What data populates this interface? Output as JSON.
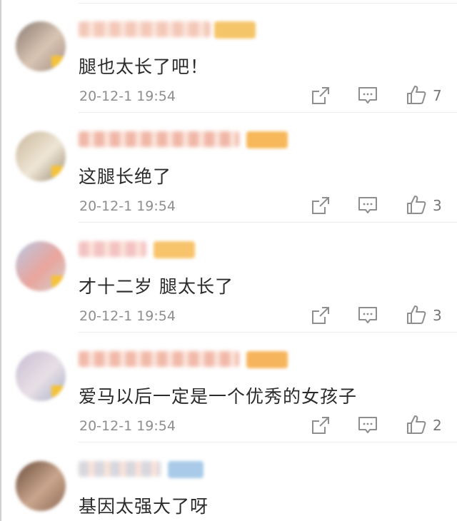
{
  "comments": [
    {
      "text": "腿也太长了吧！",
      "time": "20-12-1 19:54",
      "likes": "7",
      "avatar_colors": [
        "#8a7b73",
        "#d9c5b3",
        "#a58f86"
      ],
      "username_color": "#f3c8b8",
      "badge_color": "#f5c56a"
    },
    {
      "text": "这腿长绝了",
      "time": "20-12-1 19:54",
      "likes": "3",
      "avatar_colors": [
        "#c9b79b",
        "#efe6d6",
        "#9c8d74"
      ],
      "username_color": "#f0b7a7",
      "badge_color": "#f6b85a"
    },
    {
      "text": "才十二岁 腿太长了",
      "time": "20-12-1 19:54",
      "likes": "3",
      "avatar_colors": [
        "#b9c7e3",
        "#e9a59c",
        "#d4d0cf"
      ],
      "username_color": "#f3c2c2",
      "badge_color": "#f7c46c"
    },
    {
      "text": "爱马以后一定是一个优秀的女孩子",
      "time": "20-12-1 19:54",
      "likes": "2",
      "avatar_colors": [
        "#c7bdd3",
        "#e8dfe6",
        "#a9b1c9"
      ],
      "username_color": "#f1b9a9",
      "badge_color": "#f6b55c"
    },
    {
      "text": "基因太强大了呀",
      "time": "",
      "likes": "",
      "avatar_colors": [
        "#6b4f3d",
        "#caa58d",
        "#8d6b56"
      ],
      "username_color": "#d7d7dd",
      "badge_color": "#a9cbe9"
    }
  ],
  "icons": {
    "share": "share-icon",
    "reply": "comment-icon",
    "like": "thumbs-up-icon"
  }
}
